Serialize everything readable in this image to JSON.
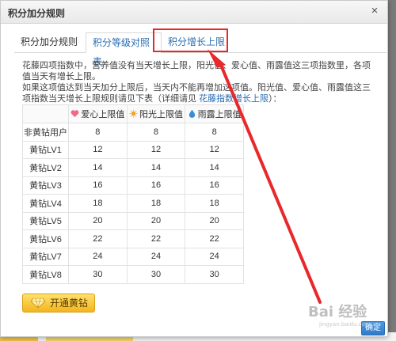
{
  "dialog": {
    "title": "积分加分规则",
    "close_glyph": "×"
  },
  "tabs": [
    {
      "label": "积分加分规则"
    },
    {
      "label": "积分等级对照表"
    },
    {
      "label": "积分增长上限"
    }
  ],
  "description": {
    "para1": "花藤四项指数中，营养值没有当天增长上限，阳光值、爱心值、雨露值这三项指数里，各项值当天有增长上限。",
    "para2_prefix": "如果这项值达到当天加分上限后，当天内不能再增加这项值。阳光值、爱心值、雨露值这三项指数当天增长上限规则请见下表（详细请见 ",
    "para2_link": "花藤指数增长上限",
    "para2_suffix": "）："
  },
  "table": {
    "headers": [
      "",
      "爱心上限值",
      "阳光上限值",
      "雨露上限值"
    ],
    "header_icons": [
      "heart-icon",
      "sun-icon",
      "water-drop-icon"
    ],
    "rows": [
      {
        "level": "非黄钻用户",
        "values": [
          "8",
          "8",
          "8"
        ]
      },
      {
        "level": "黄钻LV1",
        "values": [
          "12",
          "12",
          "12"
        ]
      },
      {
        "level": "黄钻LV2",
        "values": [
          "14",
          "14",
          "14"
        ]
      },
      {
        "level": "黄钻LV3",
        "values": [
          "16",
          "16",
          "16"
        ]
      },
      {
        "level": "黄钻LV4",
        "values": [
          "18",
          "18",
          "18"
        ]
      },
      {
        "level": "黄钻LV5",
        "values": [
          "20",
          "20",
          "20"
        ]
      },
      {
        "level": "黄钻LV6",
        "values": [
          "22",
          "22",
          "22"
        ]
      },
      {
        "level": "黄钻LV7",
        "values": [
          "24",
          "24",
          "24"
        ]
      },
      {
        "level": "黄钻LV8",
        "values": [
          "30",
          "30",
          "30"
        ]
      }
    ]
  },
  "buttons": {
    "open_yellow_diamond": "开通黄钻",
    "confirm": "确定"
  },
  "watermark": {
    "text": "Bai 经验",
    "url": "jingyan.baidu.com"
  },
  "colors": {
    "accent_link": "#2a6db3",
    "highlight_red": "#e8282b",
    "yellow_button": "#f3b51e"
  }
}
